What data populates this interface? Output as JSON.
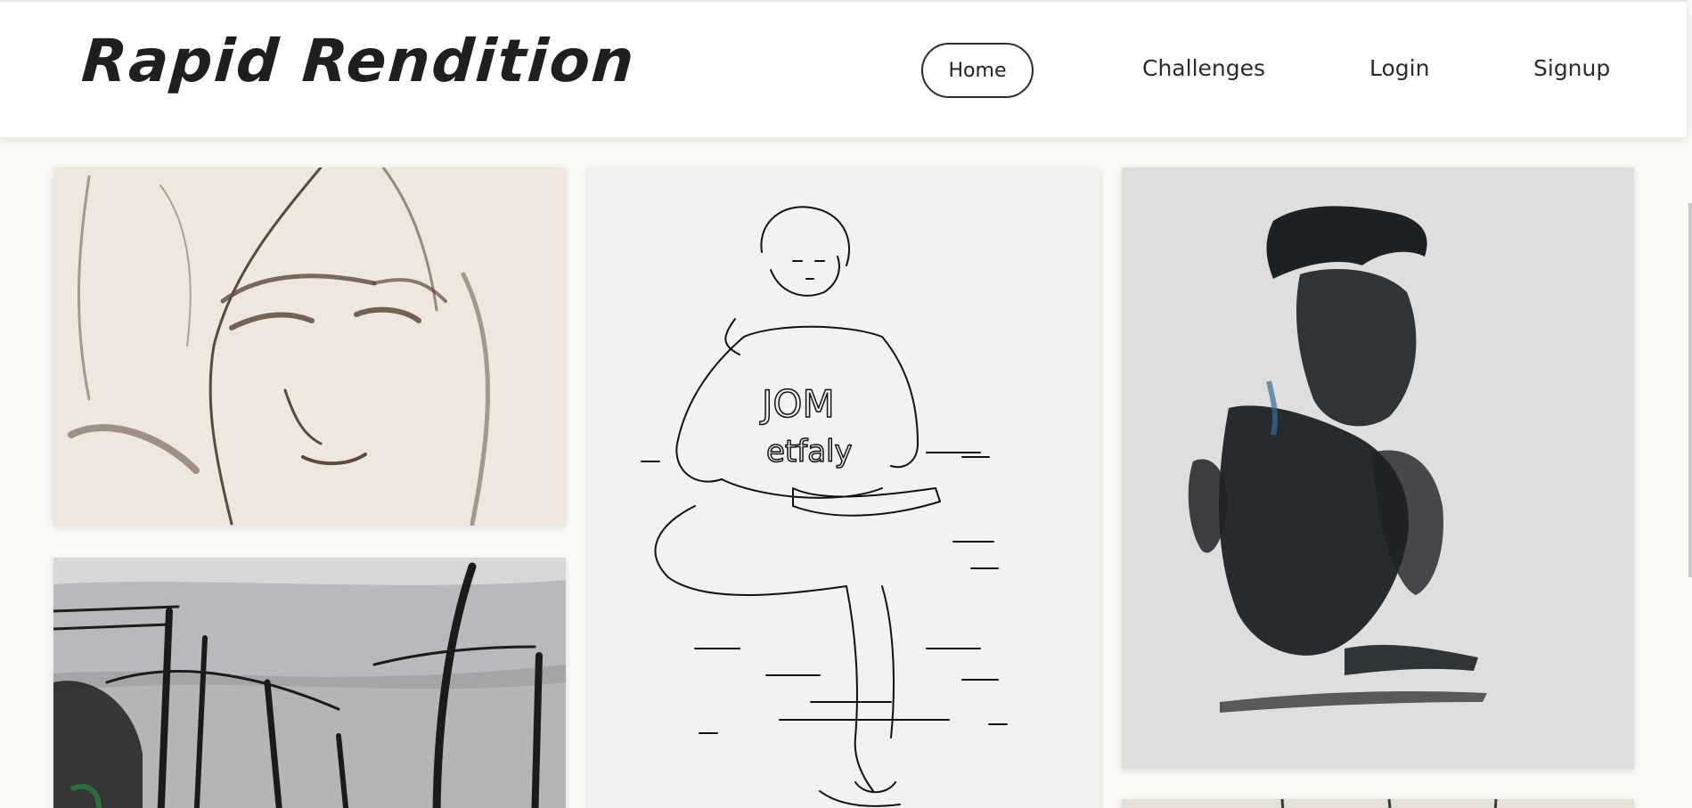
{
  "brand": {
    "logo_text": "Rapid Rendition"
  },
  "nav": {
    "home": "Home",
    "challenges": "Challenges",
    "login": "Login",
    "signup": "Signup"
  },
  "gallery": {
    "items": [
      {
        "name": "charcoal-face-sketch"
      },
      {
        "name": "ink-line-seated-figure"
      },
      {
        "name": "ink-wash-portrait"
      },
      {
        "name": "ink-wash-landscape"
      },
      {
        "name": "partial-sketch"
      }
    ]
  },
  "colors": {
    "header_bg": "#ffffff",
    "page_bg": "#faf9f6",
    "text": "#2b2b2b"
  }
}
